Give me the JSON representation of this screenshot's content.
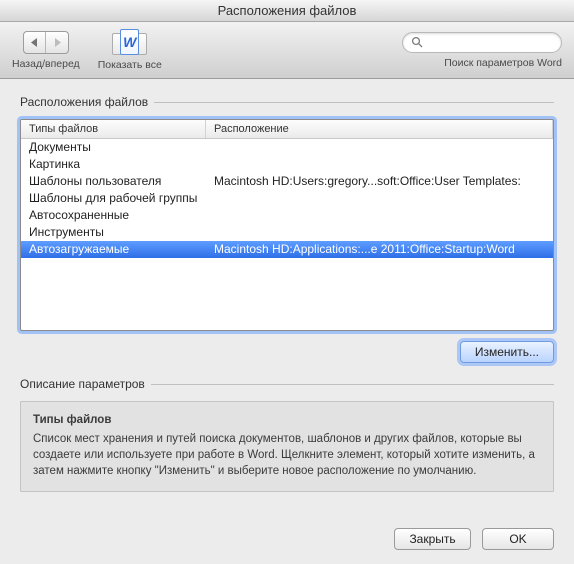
{
  "window": {
    "title": "Расположения файлов"
  },
  "toolbar": {
    "back_forward_label": "Назад/вперед",
    "show_all_label": "Показать все",
    "show_all_glyph": "W",
    "search_placeholder": "",
    "search_label": "Поиск параметров Word"
  },
  "section": {
    "legend": "Расположения файлов",
    "columns": {
      "type": "Типы файлов",
      "location": "Расположение"
    },
    "rows": [
      {
        "type": "Документы",
        "location": ""
      },
      {
        "type": "Картинка",
        "location": ""
      },
      {
        "type": "Шаблоны пользователя",
        "location": "Macintosh HD:Users:gregory...soft:Office:User Templates:"
      },
      {
        "type": "Шаблоны для рабочей группы",
        "location": ""
      },
      {
        "type": "Автосохраненные",
        "location": ""
      },
      {
        "type": "Инструменты",
        "location": ""
      },
      {
        "type": "Автозагружаемые",
        "location": "Macintosh HD:Applications:...e 2011:Office:Startup:Word"
      }
    ],
    "selected_index": 6,
    "modify_button": "Изменить..."
  },
  "description": {
    "legend": "Описание параметров",
    "title": "Типы файлов",
    "body": "Список мест хранения и путей поиска документов, шаблонов и других файлов, которые вы создаете или используете при работе в Word. Щелкните элемент, который хотите изменить, а затем нажмите кнопку \"Изменить\" и выберите новое расположение по умолчанию."
  },
  "footer": {
    "close": "Закрыть",
    "ok": "OK"
  }
}
